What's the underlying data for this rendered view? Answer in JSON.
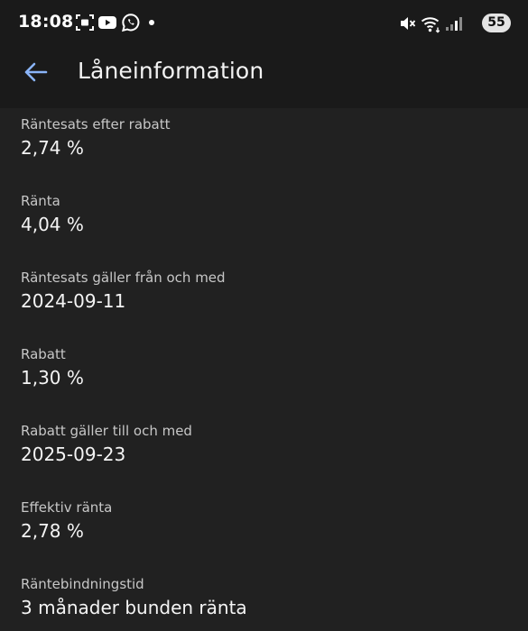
{
  "status_bar": {
    "time": "18:08",
    "battery": "55",
    "notification_icons": [
      "screenshot-icon",
      "youtube-icon",
      "whatsapp-icon",
      "dot-icon"
    ],
    "system_icons": [
      "mute-icon",
      "wifi-icon",
      "signal-icon"
    ]
  },
  "app_bar": {
    "back_icon": "arrow-left-icon",
    "title": "Låneinformation"
  },
  "colors": {
    "background": "#212121",
    "header": "#1a1a1a",
    "accent": "#8ab4f8"
  },
  "fields": [
    {
      "label": "Räntesats efter rabatt",
      "value": "2,74 %"
    },
    {
      "label": "Ränta",
      "value": "4,04 %"
    },
    {
      "label": "Räntesats gäller från och med",
      "value": "2024-09-11"
    },
    {
      "label": "Rabatt",
      "value": "1,30 %"
    },
    {
      "label": "Rabatt gäller till och med",
      "value": "2025-09-23"
    },
    {
      "label": "Effektiv ränta",
      "value": "2,78 %"
    },
    {
      "label": "Räntebindningstid",
      "value": "3 månader bunden ränta"
    }
  ]
}
